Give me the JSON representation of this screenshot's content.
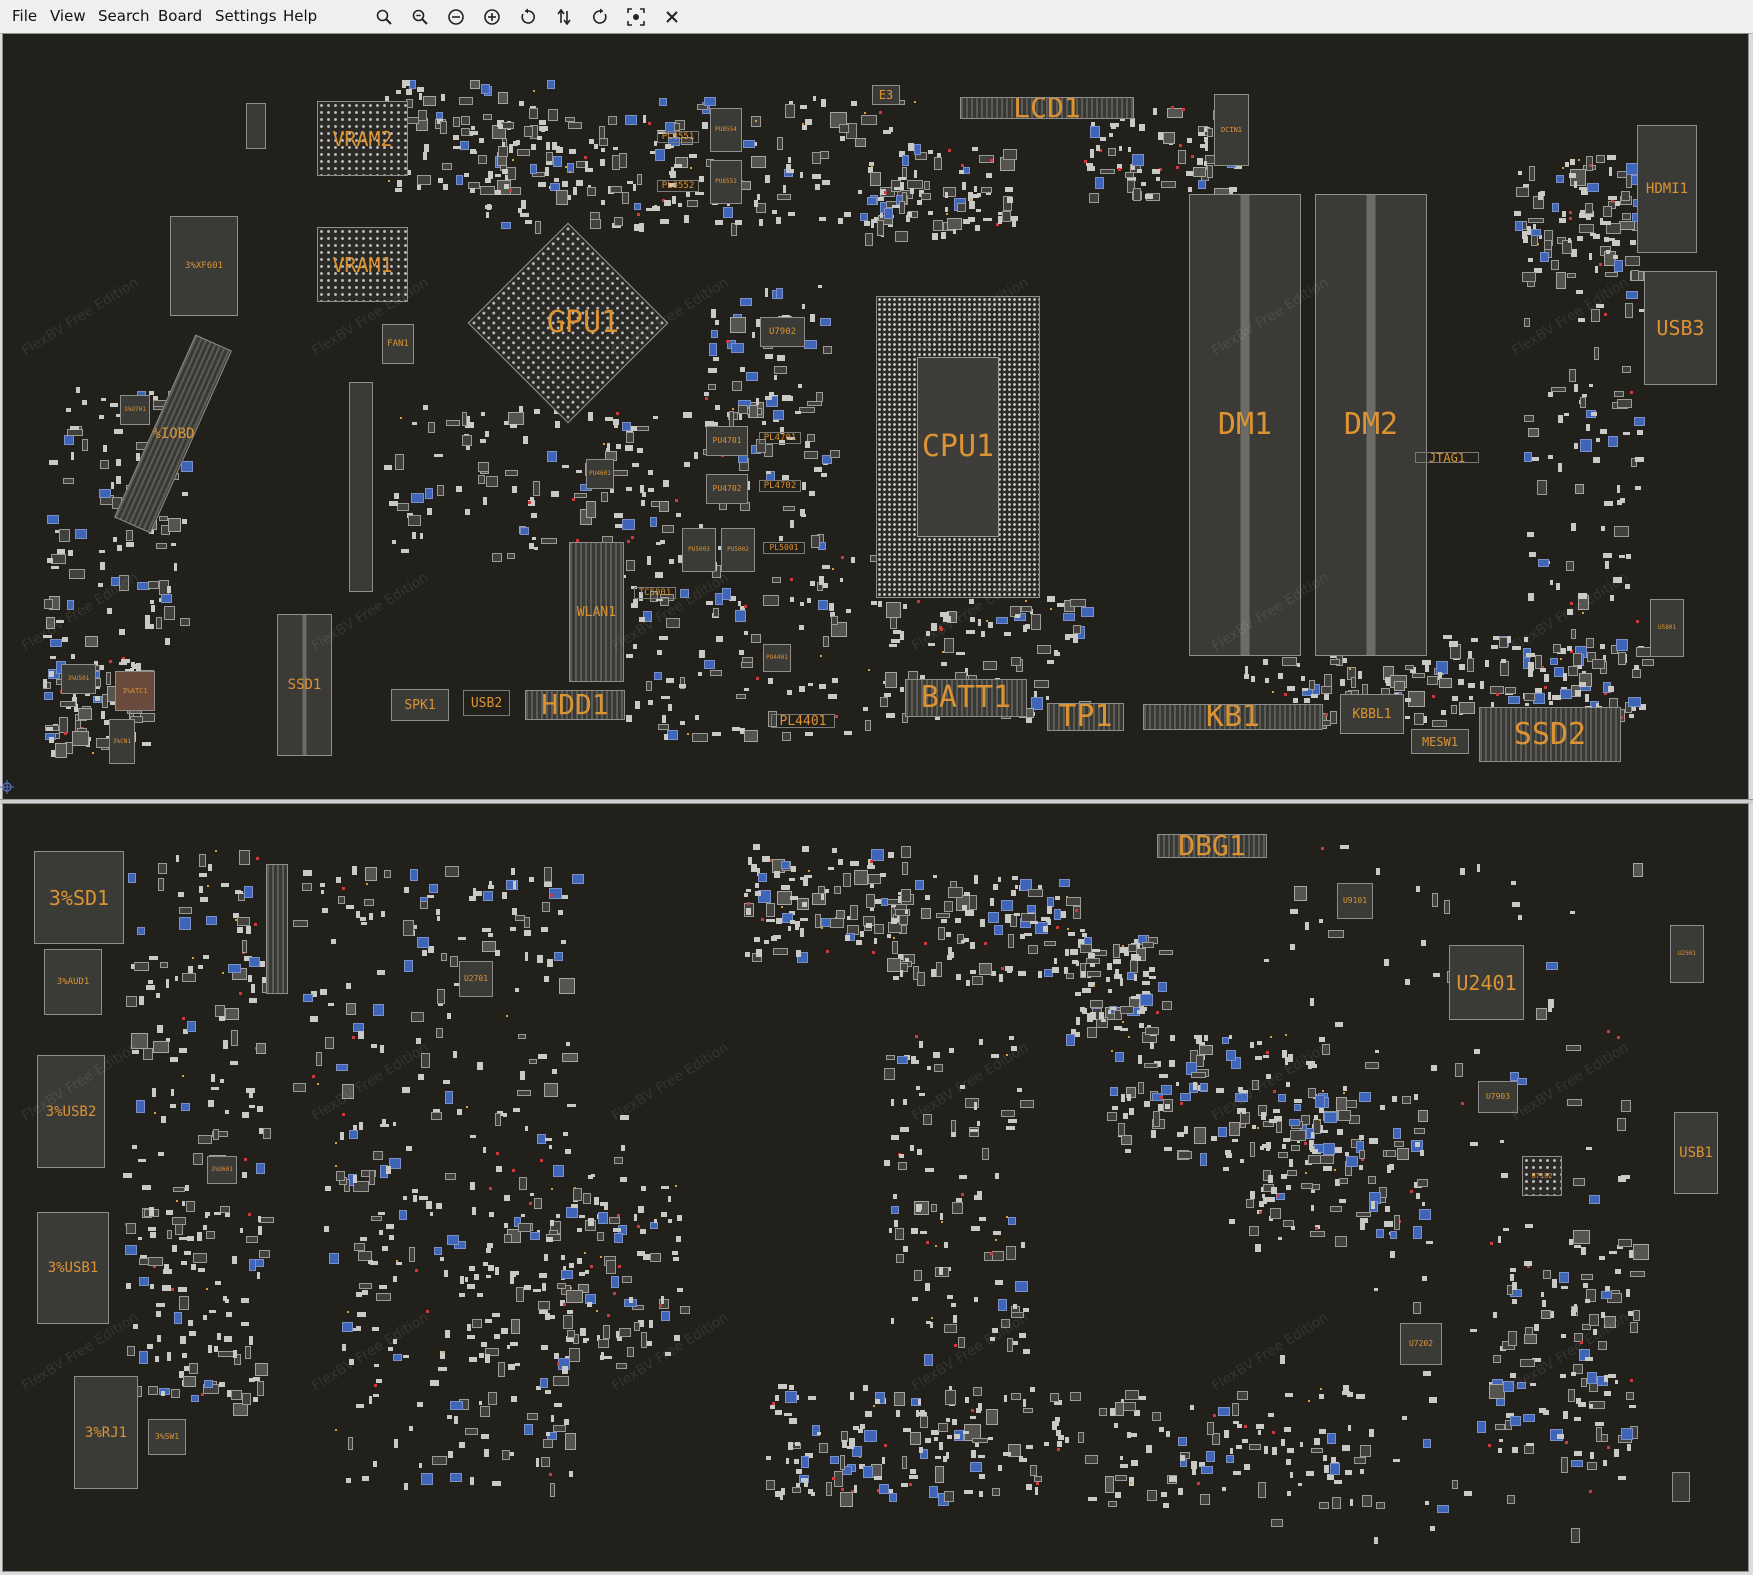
{
  "menu": [
    "File",
    "View",
    "Search",
    "Board",
    "Settings",
    "Help"
  ],
  "toolbar": [
    {
      "icon": "zoom-in-icon"
    },
    {
      "icon": "zoom-out-icon"
    },
    {
      "icon": "zoom-reset-icon"
    },
    {
      "icon": "zoom-fit-icon"
    },
    {
      "icon": "rotate-ccw-icon"
    },
    {
      "icon": "flip-icon"
    },
    {
      "icon": "rotate-cw-icon"
    },
    {
      "icon": "fit-screen-icon"
    },
    {
      "icon": "close-icon"
    }
  ],
  "watermark": "FlexBV Free Edition",
  "colors": {
    "board_bg": "#22201b",
    "label": "#dc9334",
    "pad_blue": "#3f65b8",
    "pad_red": "#d23a3a",
    "pad_green": "#6aa469"
  },
  "top_components": [
    {
      "id": "VRAM2",
      "label": "VRAM2",
      "kind": "bga"
    },
    {
      "id": "VRAM1",
      "label": "VRAM1",
      "kind": "bga"
    },
    {
      "id": "3XF601",
      "label": "3%XF601",
      "kind": "chip"
    },
    {
      "id": "3IOBD1",
      "label": "3%IOBD1",
      "kind": "conn"
    },
    {
      "id": "FAN1",
      "label": "FAN1",
      "kind": "chip"
    },
    {
      "id": "GPU1",
      "label": "GPU1",
      "kind": "gpu"
    },
    {
      "id": "LCD1",
      "label": "LCD1",
      "kind": "conn"
    },
    {
      "id": "E3",
      "label": "E3",
      "kind": "chip"
    },
    {
      "id": "DCIN1",
      "label": "DCIN1",
      "kind": "chip"
    },
    {
      "id": "HDMI1",
      "label": "HDMI1",
      "kind": "chip"
    },
    {
      "id": "USB3",
      "label": "USB3",
      "kind": "chip"
    },
    {
      "id": "CPU1",
      "label": "CPU1",
      "kind": "cpu"
    },
    {
      "id": "DM1",
      "label": "DM1",
      "kind": "slot"
    },
    {
      "id": "DM2",
      "label": "DM2",
      "kind": "slot"
    },
    {
      "id": "JTAG1",
      "label": "JTAG1",
      "kind": "ghost"
    },
    {
      "id": "U7902",
      "label": "U7902",
      "kind": "chip"
    },
    {
      "id": "PL4701",
      "label": "PL4701",
      "kind": "ghost"
    },
    {
      "id": "PL4702",
      "label": "PL4702",
      "kind": "ghost"
    },
    {
      "id": "PL5001",
      "label": "PL5001",
      "kind": "ghost"
    },
    {
      "id": "PL8551",
      "label": "PL8551",
      "kind": "ghost"
    },
    {
      "id": "PL8552",
      "label": "PL8552",
      "kind": "ghost"
    },
    {
      "id": "PU4701",
      "label": "PU4701",
      "kind": "chip"
    },
    {
      "id": "PU4702",
      "label": "PU4702",
      "kind": "chip"
    },
    {
      "id": "PU4601",
      "label": "PU4601",
      "kind": "chip"
    },
    {
      "id": "PU5003",
      "label": "PU5003",
      "kind": "chip"
    },
    {
      "id": "PU5002",
      "label": "PU5002",
      "kind": "chip"
    },
    {
      "id": "PU8554",
      "label": "PU8554",
      "kind": "chip"
    },
    {
      "id": "PU8552",
      "label": "PU8552",
      "kind": "chip"
    },
    {
      "id": "WLAN1",
      "label": "WLAN1",
      "kind": "conn"
    },
    {
      "id": "TC5001",
      "label": "TC5001",
      "kind": "ghost"
    },
    {
      "id": "SSD1",
      "label": "SSD1",
      "kind": "slot"
    },
    {
      "id": "SPK1",
      "label": "SPK1",
      "kind": "chip"
    },
    {
      "id": "USB2",
      "label": "USB2",
      "kind": "ghost"
    },
    {
      "id": "HDD1",
      "label": "HDD1",
      "kind": "conn"
    },
    {
      "id": "PL4401",
      "label": "PL4401",
      "kind": "ghost"
    },
    {
      "id": "PU4401",
      "label": "PU4401",
      "kind": "chip"
    },
    {
      "id": "BATT1",
      "label": "BATT1",
      "kind": "conn"
    },
    {
      "id": "TP1",
      "label": "TP1",
      "kind": "conn"
    },
    {
      "id": "KB1",
      "label": "KB1",
      "kind": "conn"
    },
    {
      "id": "KBBL1",
      "label": "KBBL1",
      "kind": "chip"
    },
    {
      "id": "MESW1",
      "label": "MESW1",
      "kind": "chip"
    },
    {
      "id": "SSD2",
      "label": "SSD2",
      "kind": "conn"
    },
    {
      "id": "U5801",
      "label": "U5801",
      "kind": "chip"
    },
    {
      "id": "3ATC1",
      "label": "3%ATC1",
      "kind": "chip"
    },
    {
      "id": "3CN1",
      "label": "3%CN1",
      "kind": "chip"
    },
    {
      "id": "3U501",
      "label": "3%U501",
      "kind": "chip"
    },
    {
      "id": "3U701",
      "label": "3%U701",
      "kind": "chip"
    }
  ],
  "bottom_components": [
    {
      "id": "3SD1",
      "label": "3%SD1",
      "kind": "chip"
    },
    {
      "id": "3AUD1",
      "label": "3%AUD1",
      "kind": "chip"
    },
    {
      "id": "3USB2",
      "label": "3%USB2",
      "kind": "chip"
    },
    {
      "id": "3USB1",
      "label": "3%USB1",
      "kind": "chip"
    },
    {
      "id": "3RJ1",
      "label": "3%RJ1",
      "kind": "chip"
    },
    {
      "id": "3SW1",
      "label": "3%SW1",
      "kind": "chip"
    },
    {
      "id": "3U601",
      "label": "3%U601",
      "kind": "chip"
    },
    {
      "id": "U2701",
      "label": "U2701",
      "kind": "chip"
    },
    {
      "id": "DBG1",
      "label": "DBG1",
      "kind": "conn"
    },
    {
      "id": "U9101",
      "label": "U9101",
      "kind": "chip"
    },
    {
      "id": "U2401",
      "label": "U2401",
      "kind": "chip"
    },
    {
      "id": "U7903",
      "label": "U7903",
      "kind": "chip"
    },
    {
      "id": "U7102",
      "label": "U7102",
      "kind": "bga"
    },
    {
      "id": "U7202",
      "label": "U7202",
      "kind": "chip"
    },
    {
      "id": "U2501",
      "label": "U2501",
      "kind": "chip"
    },
    {
      "id": "USB1",
      "label": "USB1",
      "kind": "chip"
    }
  ]
}
